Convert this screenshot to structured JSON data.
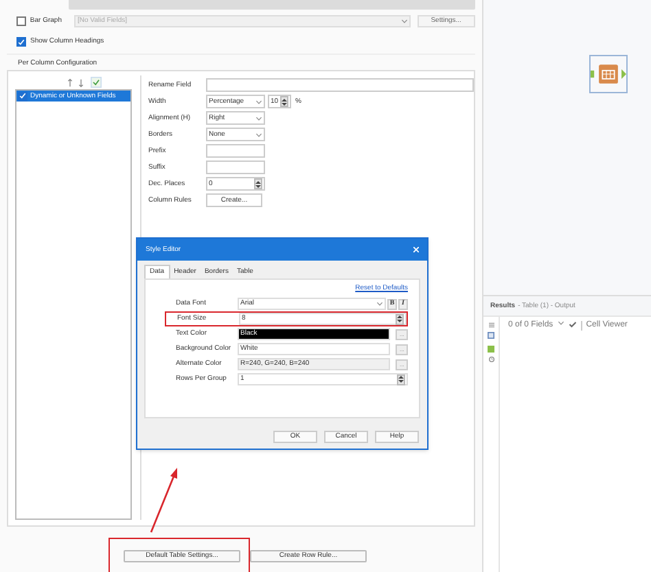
{
  "bar_graph": {
    "label": "Bar Graph",
    "checked": false,
    "field": "[No Valid Fields]",
    "button": "Settings..."
  },
  "show_column_headings": {
    "label": "Show Column Headings",
    "checked": true
  },
  "per_column": {
    "title": "Per Column Configuration",
    "fields": [
      {
        "name": "Dynamic or Unknown Fields",
        "checked": true,
        "selected": true
      }
    ],
    "form": [
      {
        "kind": "text",
        "label": "Rename Field"
      },
      {
        "kind": "select_spin",
        "label": "Width",
        "value": "Percentage",
        "spin": "10",
        "unit": "%"
      },
      {
        "kind": "select",
        "label": "Alignment (H)",
        "value": "Right"
      },
      {
        "kind": "select",
        "label": "Borders",
        "value": "None"
      },
      {
        "kind": "text",
        "label": "Prefix"
      },
      {
        "kind": "text",
        "label": "Suffix"
      },
      {
        "kind": "spin",
        "label": "Dec. Places",
        "value": "0"
      },
      {
        "kind": "button",
        "label": "Column Rules",
        "value": "Create..."
      }
    ]
  },
  "style_editor": {
    "title": "Style Editor",
    "tabs": [
      {
        "label": "Data",
        "selected": true
      },
      {
        "label": "Header",
        "selected": false
      },
      {
        "label": "Borders",
        "selected": false
      },
      {
        "label": "Table",
        "selected": false
      }
    ],
    "reset": "Reset to Defaults",
    "rows": [
      {
        "kind": "font",
        "label": "Data Font",
        "value": "Arial",
        "bold": "B",
        "italic": "I"
      },
      {
        "kind": "spin",
        "label": "Font Size",
        "value": "8",
        "highlighted": true
      },
      {
        "kind": "color",
        "label": "Text Color",
        "value": "Black",
        "color": "#000000",
        "more": "..."
      },
      {
        "kind": "color",
        "label": "Background Color",
        "value": "White",
        "color": "#ffffff",
        "more": "..."
      },
      {
        "kind": "color",
        "label": "Alternate Color",
        "value": "R=240, G=240, B=240",
        "color": "#f0f0f0",
        "more": "..."
      },
      {
        "kind": "spin",
        "label": "Rows Per Group",
        "value": "1",
        "highlighted": false
      }
    ],
    "buttons": [
      "OK",
      "Cancel",
      "Help"
    ]
  },
  "bottom_buttons": [
    {
      "label": "Default Table Settings...",
      "highlighted": true
    },
    {
      "label": "Create Row Rule...",
      "highlighted": false
    }
  ],
  "results": {
    "title": "Results",
    "subtitle": "- Table (1) - Output",
    "fields": "0 of 0 Fields",
    "viewer": "Cell Viewer"
  }
}
